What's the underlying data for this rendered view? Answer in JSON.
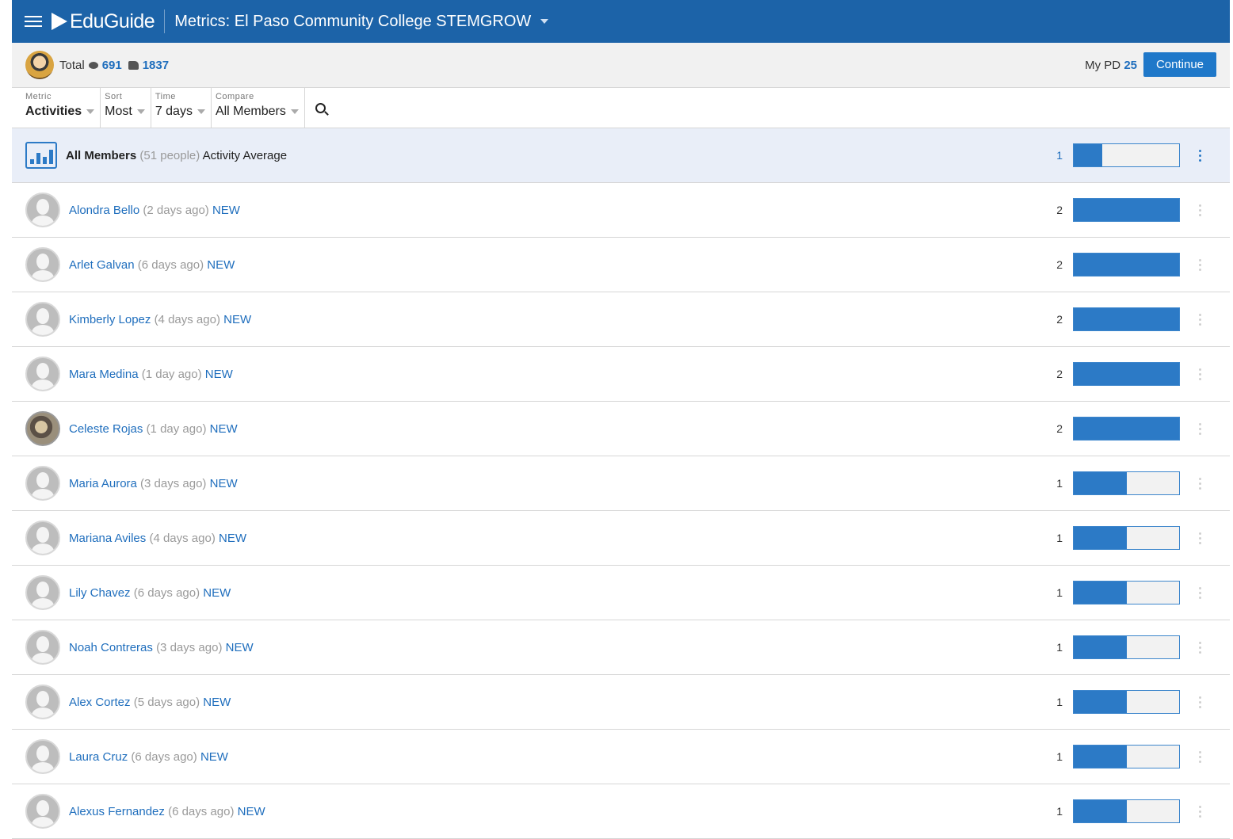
{
  "header": {
    "logo": "EduGuide",
    "title": "Metrics: El Paso Community College STEMGROW"
  },
  "summary": {
    "total_label": "Total",
    "comments": "691",
    "likes": "1837",
    "mypd_label": "My PD",
    "mypd_value": "25",
    "continue_label": "Continue"
  },
  "filters": [
    {
      "label": "Metric",
      "value": "Activities"
    },
    {
      "label": "Sort",
      "value": "Most"
    },
    {
      "label": "Time",
      "value": "7 days"
    },
    {
      "label": "Compare",
      "value": "All Members"
    }
  ],
  "average": {
    "name": "All Members",
    "people": "(51 people)",
    "suffix": "Activity Average",
    "value": "1",
    "fill": 0.27
  },
  "members": [
    {
      "name": "Alondra Bello",
      "ago": "(2 days ago)",
      "badge": "NEW",
      "value": "2",
      "fill": 1.0,
      "photo": false
    },
    {
      "name": "Arlet Galvan",
      "ago": "(6 days ago)",
      "badge": "NEW",
      "value": "2",
      "fill": 1.0,
      "photo": false
    },
    {
      "name": "Kimberly Lopez",
      "ago": "(4 days ago)",
      "badge": "NEW",
      "value": "2",
      "fill": 1.0,
      "photo": false
    },
    {
      "name": "Mara Medina",
      "ago": "(1 day ago)",
      "badge": "NEW",
      "value": "2",
      "fill": 1.0,
      "photo": false
    },
    {
      "name": "Celeste Rojas",
      "ago": "(1 day ago)",
      "badge": "NEW",
      "value": "2",
      "fill": 1.0,
      "photo": true
    },
    {
      "name": "Maria Aurora",
      "ago": "(3 days ago)",
      "badge": "NEW",
      "value": "1",
      "fill": 0.5,
      "photo": false
    },
    {
      "name": "Mariana Aviles",
      "ago": "(4 days ago)",
      "badge": "NEW",
      "value": "1",
      "fill": 0.5,
      "photo": false
    },
    {
      "name": "Lily Chavez",
      "ago": "(6 days ago)",
      "badge": "NEW",
      "value": "1",
      "fill": 0.5,
      "photo": false
    },
    {
      "name": "Noah Contreras",
      "ago": "(3 days ago)",
      "badge": "NEW",
      "value": "1",
      "fill": 0.5,
      "photo": false
    },
    {
      "name": "Alex Cortez",
      "ago": "(5 days ago)",
      "badge": "NEW",
      "value": "1",
      "fill": 0.5,
      "photo": false
    },
    {
      "name": "Laura Cruz",
      "ago": "(6 days ago)",
      "badge": "NEW",
      "value": "1",
      "fill": 0.5,
      "photo": false
    },
    {
      "name": "Alexus Fernandez",
      "ago": "(6 days ago)",
      "badge": "NEW",
      "value": "1",
      "fill": 0.5,
      "photo": false
    }
  ],
  "colors": {
    "brand": "#1c63a8",
    "accent": "#2c7ac6",
    "link": "#1f6ebd"
  }
}
